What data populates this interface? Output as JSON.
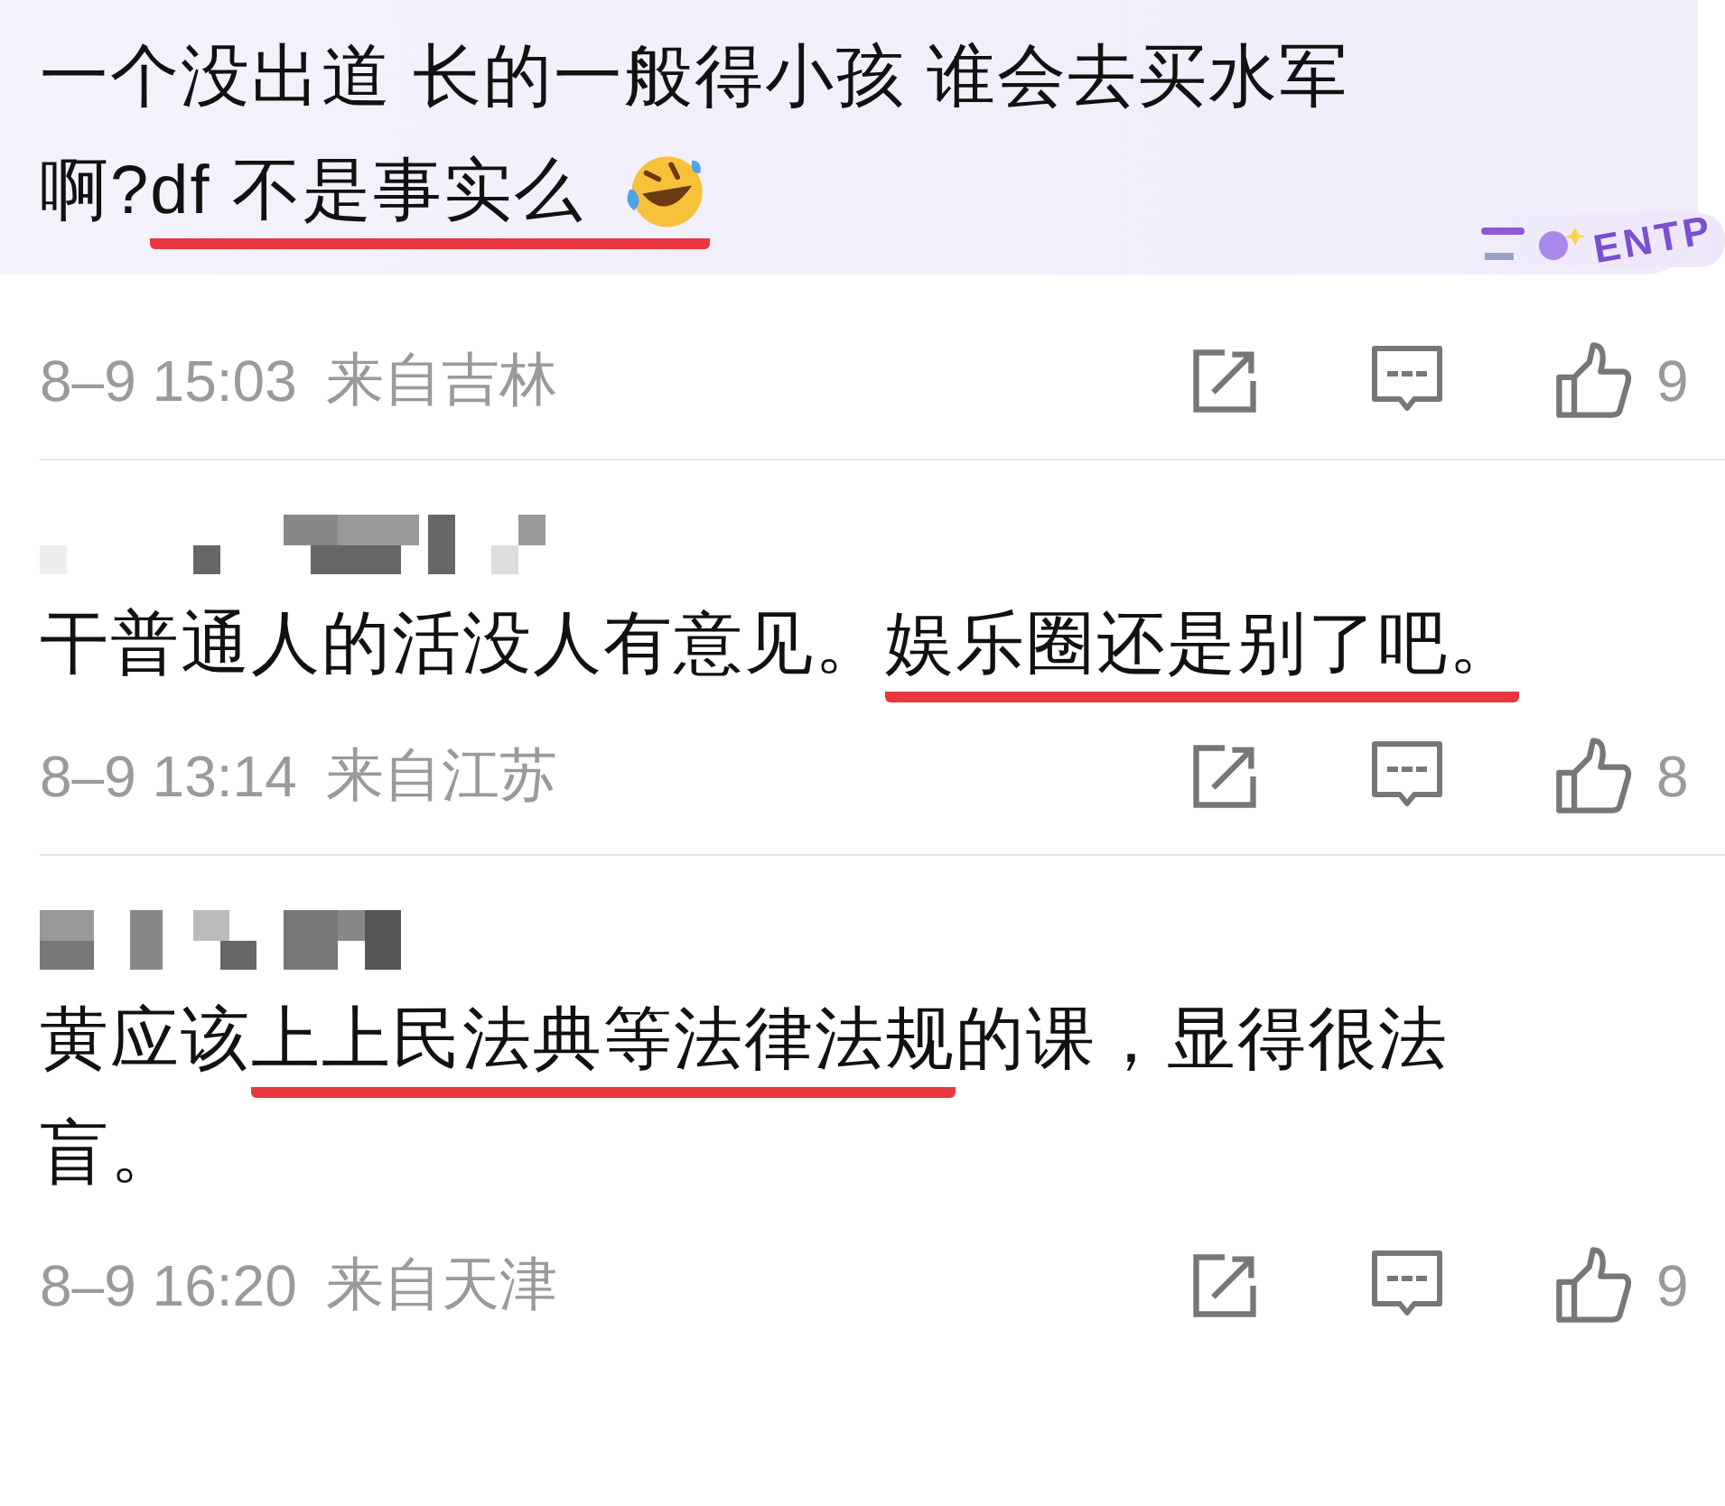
{
  "comments": [
    {
      "highlighted": true,
      "badge": "ENTP",
      "lines": [
        [
          {
            "text": "一个没出道 长的一般得小孩 谁会去买水军",
            "underlined": false
          }
        ],
        [
          {
            "text": "啊? ",
            "underlined": false
          },
          {
            "text": "df 不是事实么 ",
            "underlined": true,
            "emoji": true
          }
        ]
      ],
      "date": "8–9 15:03",
      "location": "来自吉林",
      "likes": "9"
    },
    {
      "highlighted": false,
      "masked_name": true,
      "lines": [
        [
          {
            "text": "干普通人的活没人有意见。",
            "underlined": false
          },
          {
            "text": "娱乐圈还是别了吧。",
            "underlined": true
          }
        ]
      ],
      "date": "8–9 13:14",
      "location": "来自江苏",
      "likes": "8"
    },
    {
      "highlighted": false,
      "masked_name": true,
      "lines": [
        [
          {
            "text": "黄应该",
            "underlined": false
          },
          {
            "text": "上上民法典等法律法规",
            "underlined": true
          },
          {
            "text": "的课，显得很法",
            "underlined": false
          }
        ],
        [
          {
            "text": "盲。",
            "underlined": false
          }
        ]
      ],
      "date": "8–9 16:20",
      "location": "来自天津",
      "likes": "9"
    }
  ]
}
